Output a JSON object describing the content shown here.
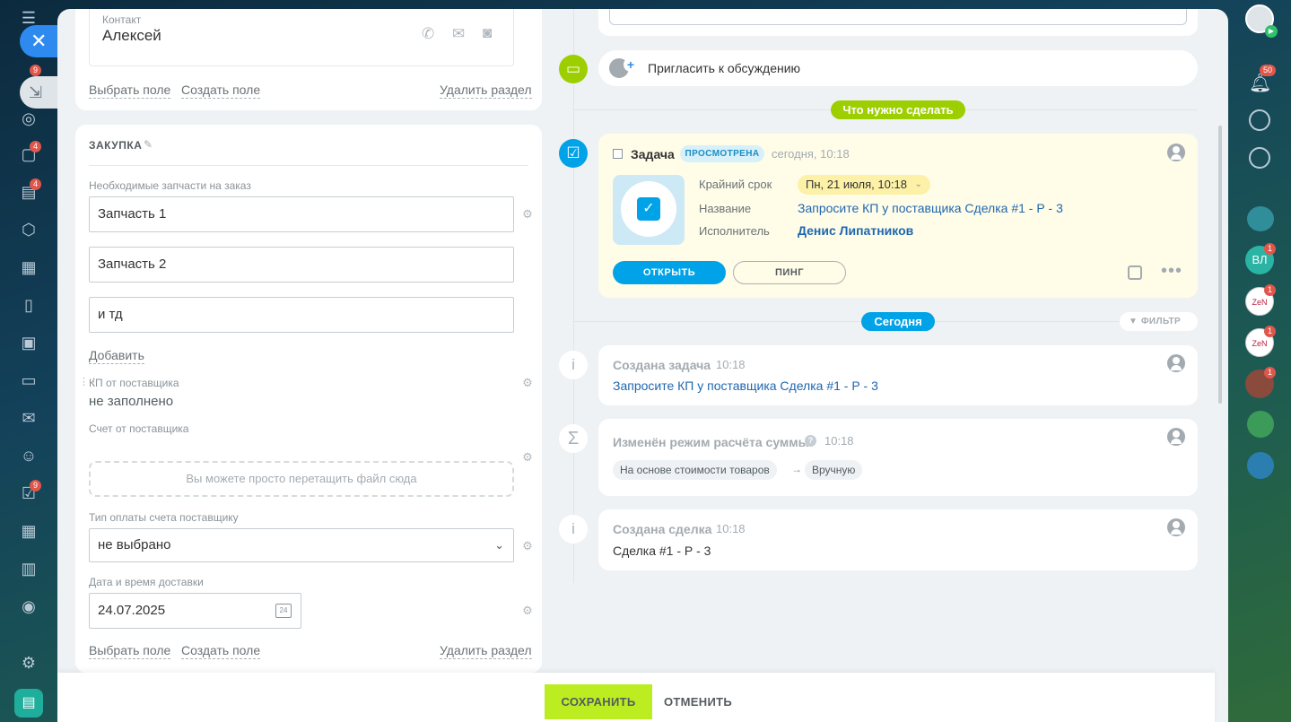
{
  "left_rail": {
    "badges": {
      "tasks": "9",
      "chats": "4",
      "docs": "4",
      "checks": "9"
    }
  },
  "right_rail": {
    "notifications_badge": "50",
    "avatars": [
      {
        "initials": "ВЛ",
        "badge": "1",
        "color": "#2bb3a3"
      },
      {
        "initials": "ZeN",
        "badge": "1",
        "color": "#ffffff"
      },
      {
        "initials": "ZeN",
        "badge": "1",
        "color": "#ffffff"
      },
      {
        "initials": "",
        "badge": "1",
        "color": "#8a4a3c"
      }
    ]
  },
  "contact": {
    "label": "Контакт",
    "name": "Алексей",
    "links": {
      "choose_field": "Выбрать поле",
      "create_field": "Создать поле",
      "delete_section": "Удалить раздел"
    }
  },
  "purchase": {
    "title": "ЗАКУПКА",
    "parts_label": "Необходимые запчасти на заказ",
    "parts": [
      "Запчасть 1",
      "Запчасть 2",
      "и тд"
    ],
    "add_label": "Добавить",
    "kp_label": "КП от поставщика",
    "kp_value": "не заполнено",
    "invoice_label": "Счет от поставщика",
    "dropzone_text": "Вы можете просто перетащить файл сюда",
    "payment_type_label": "Тип оплаты счета поставщику",
    "payment_type_value": "не выбрано",
    "delivery_label": "Дата и время доставки",
    "delivery_value": "24.07.2025",
    "calendar_day": "24",
    "links": {
      "choose_field": "Выбрать поле",
      "create_field": "Создать поле",
      "delete_section": "Удалить раздел"
    }
  },
  "timeline": {
    "invite_label": "Пригласить к обсуждению",
    "todo_pill": "Что нужно сделать",
    "task": {
      "title": "Задача",
      "status": "ПРОСМОТРЕНА",
      "time": "сегодня, 10:18",
      "deadline_label": "Крайний срок",
      "deadline_value": "Пн, 21 июля, 10:18",
      "name_label": "Название",
      "name_value": "Запросите КП у поставщика Сделка #1 - Р - 3",
      "assignee_label": "Исполнитель",
      "assignee_value": "Денис Липатников",
      "open_button": "ОТКРЫТЬ",
      "ping_button": "ПИНГ"
    },
    "today_pill": "Сегодня",
    "filter_label": "ФИЛЬТР",
    "events": [
      {
        "title": "Создана задача",
        "time": "10:18",
        "body": "Запросите КП у поставщика Сделка #1 - Р - 3"
      },
      {
        "title": "Изменён режим расчёта суммы",
        "time": "10:18",
        "from": "На основе стоимости товаров",
        "to": "Вручную"
      },
      {
        "title": "Создана сделка",
        "time": "10:18",
        "body": "Сделка #1 - Р - 3"
      }
    ]
  },
  "footer": {
    "save": "СОХРАНИТЬ",
    "cancel": "ОТМЕНИТЬ"
  },
  "colors": {
    "accent_green": "#9dcf00",
    "accent_blue": "#00a2e8",
    "link": "#2067b0",
    "task_bg": "#fffde8"
  }
}
